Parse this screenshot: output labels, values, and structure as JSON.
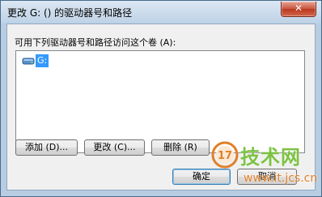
{
  "window": {
    "title": "更改 G: () 的驱动器号和路径",
    "close_label": "✕"
  },
  "dialog": {
    "volume_access_label": "可用下列驱动器号和路径访问这个卷 (A):",
    "list_items": [
      {
        "label": "G:",
        "icon": "drive-icon",
        "selected": true
      }
    ]
  },
  "buttons": {
    "add": "添加 (D)...",
    "change": "更改 (C)...",
    "remove": "删除 (R)",
    "ok": "确定",
    "cancel": "取消"
  },
  "watermark": {
    "logo_text": "17",
    "brand_text": "技术网",
    "url": "www.it.jcs.cn"
  },
  "colors": {
    "selection": "#3399ff",
    "title_bar": "#bed2e6",
    "close_button": "#c8563f",
    "watermark_green": "#7dc243",
    "watermark_orange": "#e08028"
  }
}
